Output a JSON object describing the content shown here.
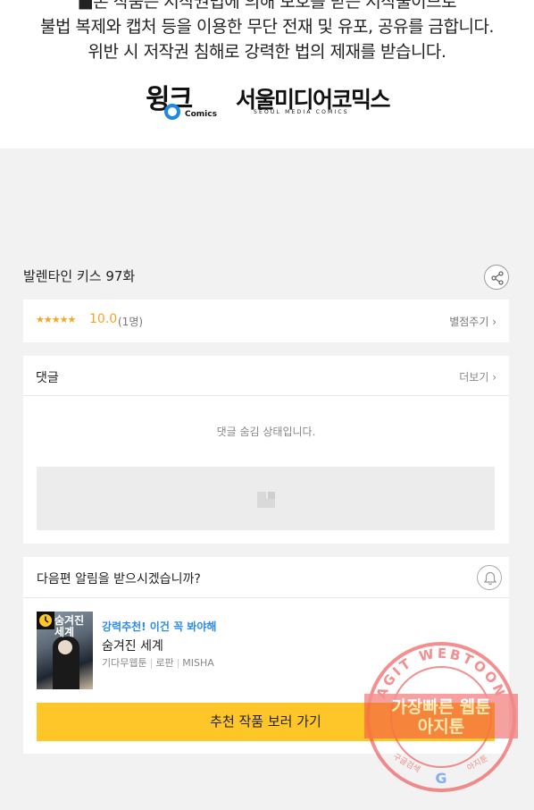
{
  "notice": {
    "line0": "■본 작품은 저작권법에 의해 보호를 받는 저작물이므로",
    "line1": "불법 복제와 캡처 등을 이용한 무단 전재 및 유포, 공유를 금합니다.",
    "line2": "위반 시 저작권 침해로 강력한 법의 제재를 받습니다."
  },
  "logos": {
    "wink_text": "윙크",
    "wink_sub": "Comics",
    "seoul_text": "서울미디어코믹스",
    "seoul_sub": "SEOUL MEDIA COMICS"
  },
  "episode": {
    "title": "발렌타인 키스 97화",
    "share_icon": "share-icon"
  },
  "rating": {
    "stars": "★★★★★",
    "score": "10.0",
    "count": "(1명)",
    "rate_link": "별점주기 ›"
  },
  "comments": {
    "title": "댓글",
    "more_link": "더보기 ›",
    "hidden_notice": "댓글 숨김 상태입니다."
  },
  "next_episode": {
    "question": "다음편 알림을 받으시겠습니까?",
    "bell_icon": "bell-icon"
  },
  "recommendation": {
    "tag": "강력추천! 이건 꼭 봐야해",
    "title": "숨겨진 세계",
    "genre": "기다무웹툰",
    "category": "로판",
    "author": "MISHA",
    "thumb_title": "숨겨진 세계",
    "button_label": "추천 작품 보러 가기"
  },
  "watermark": {
    "ring_text": "AGIT WEBTOON",
    "line1": "가장빠른 웹툰",
    "line2": "아지툰",
    "bottom_left": "구글검색",
    "bottom_right": "아지툰",
    "google_letter": "G"
  },
  "colors": {
    "accent_yellow": "#ffc62a",
    "star_orange": "#f5a623",
    "tag_blue": "#2d8bf0",
    "watermark_red": "#ef4b4b"
  }
}
